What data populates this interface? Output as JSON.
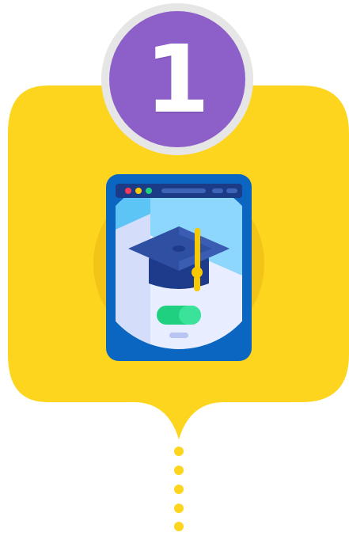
{
  "step": {
    "number": "1"
  },
  "icons": {
    "badge": "number-badge-icon",
    "card": "speech-bubble-card",
    "illustration": "online-education-tablet-graduation-cap-icon",
    "connector": "dotted-connector-icon"
  },
  "colors": {
    "card_yellow": "#FDD51F",
    "circle_yellow": "#F2C417",
    "badge_purple": "#8C5FC9",
    "badge_border": "#E6E6E6",
    "cap_navy": "#2B4B9B",
    "tassel_yellow": "#F9C900",
    "button_green": "#1FD080"
  }
}
